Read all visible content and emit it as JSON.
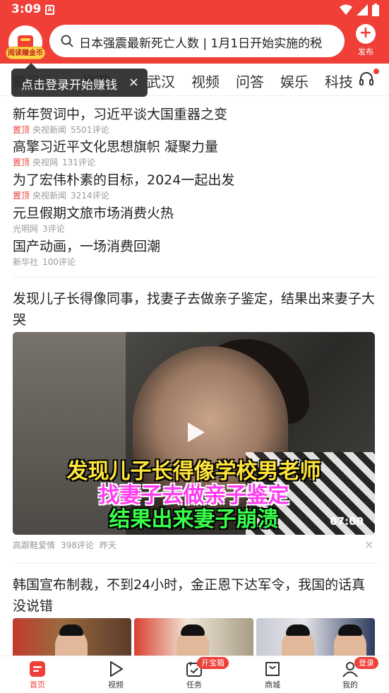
{
  "status": {
    "time": "3:09",
    "notification": "A"
  },
  "header": {
    "earn_badge": "阅读赚金币",
    "search_text": "日本强震最新死亡人数 | 1月1日开始实施的税",
    "publish_label": "发布"
  },
  "tabs": [
    "要闻",
    "推荐",
    "武汉",
    "视频",
    "问答",
    "娱乐",
    "科技"
  ],
  "tooltip": {
    "text": "点击登录开始赚钱",
    "close": "×"
  },
  "news": [
    {
      "title": "新年贺词中，习近平谈大国重器之变",
      "pin": "置顶",
      "source": "央视新闻",
      "comments": "5501评论"
    },
    {
      "title": "高擎习近平文化思想旗帜 凝聚力量",
      "pin": "置顶",
      "source": "央视网",
      "comments": "131评论"
    },
    {
      "title": "为了宏伟朴素的目标，2024一起出发",
      "pin": "置顶",
      "source": "央视新闻",
      "comments": "3214评论"
    },
    {
      "title": "元旦假期文旅市场消费火热",
      "pin": "",
      "source": "光明网",
      "comments": "3评论"
    },
    {
      "title": "国产动画，一场消费回潮",
      "pin": "",
      "source": "新华社",
      "comments": "100评论"
    }
  ],
  "video_article": {
    "title": "发现儿子长得像同事，找妻子去做亲子鉴定，结果出来妻子大哭",
    "captions": [
      "发现儿子长得像学校男老师",
      "找妻子去做亲子鉴定",
      "结果出来妻子崩溃"
    ],
    "duration": "07:00",
    "source": "高跟鞋爱情",
    "comments": "398评论",
    "time": "昨天"
  },
  "next_article": {
    "title": "韩国宣布制裁，不到24小时，金正恩下达军令，我国的话真没说错"
  },
  "bottom_nav": [
    {
      "label": "首页",
      "icon": "home-icon",
      "badge": ""
    },
    {
      "label": "视频",
      "icon": "play-icon",
      "badge": ""
    },
    {
      "label": "任务",
      "icon": "task-icon",
      "badge": "开宝箱"
    },
    {
      "label": "商城",
      "icon": "shop-bag-icon",
      "badge": ""
    },
    {
      "label": "我的",
      "icon": "user-icon",
      "badge": "登录"
    }
  ],
  "colors": {
    "brand_red": "#ef3f37",
    "meta_gray": "#999999"
  }
}
